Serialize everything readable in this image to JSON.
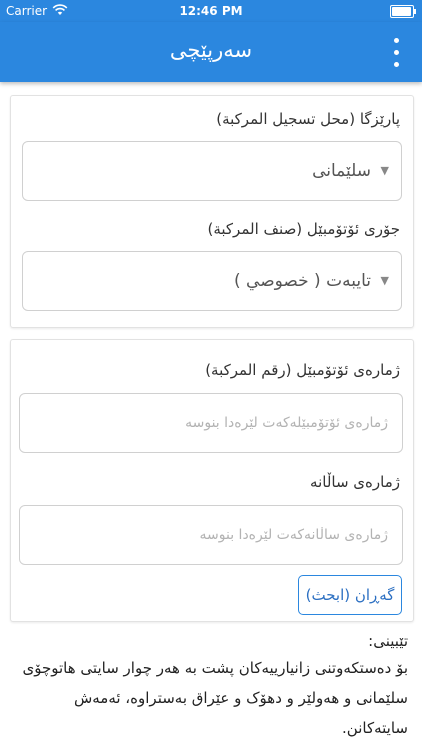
{
  "status_bar": {
    "carrier": "Carrier",
    "time": "12:46 PM",
    "battery_level": 0.95
  },
  "app_bar": {
    "title": "سەرپێچی",
    "menu_icon": "more-vertical-icon"
  },
  "vehicle_form": {
    "province_label": "پارێزگا (محل تسجيل المركبة)",
    "province_value": "سلێمانی",
    "type_label": "جۆری ئۆتۆمبێل (صنف المركبة)",
    "type_value": "تایبەت ( خصوصي )"
  },
  "search_form": {
    "plate_label": "ژمارەی ئۆتۆمبێل (رقم المركبة)",
    "plate_placeholder": "ژمارەی ئۆتۆمبێلەکەت لێرەدا بنوسە",
    "year_label": "ژمارەی ساڵانە",
    "year_placeholder": "ژمارەی ساڵانەکەت لێرەدا بنوسە",
    "search_label": "گەڕان (ابحث)"
  },
  "note": {
    "title": "تێبینی:",
    "body": "بۆ دەستکەوتنی زانیارییەکان پشت بە هەر چوار سایتی هاتوچۆی سلێمانی و هەولێر و دهۆک و عێراق بەستراوە، ئەمەش سایتەکانن."
  },
  "colors": {
    "primary": "#2b87df",
    "button_text": "#2b6fc2"
  }
}
